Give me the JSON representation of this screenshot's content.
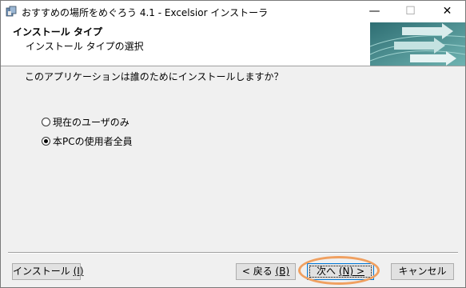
{
  "window": {
    "title": "おすすめの場所をめぐろう 4.1 - Excelsior インストーラ",
    "minimize_glyph": "—",
    "maximize_glyph": "☐",
    "close_glyph": "✕"
  },
  "header": {
    "title": "インストール タイプ",
    "subtitle": "インストール タイプの選択"
  },
  "content": {
    "question": "このアプリケーションは誰のためにインストールしますか？",
    "options": [
      {
        "label": "現在のユーザのみ",
        "selected": false
      },
      {
        "label": "本PCの使用者全員",
        "selected": true
      }
    ]
  },
  "footer": {
    "install_label": "インストール",
    "install_key": "(I)",
    "back_label": "< 戻る",
    "back_key": "(B)",
    "next_label": "次へ",
    "next_key": "(N) >",
    "cancel_label": "キャンセル"
  },
  "colors": {
    "highlight_ellipse": "#f0a060",
    "focus_border": "#0078d7",
    "banner_teal": "#5f9ea0"
  },
  "icons": [
    "app-installer-icon",
    "minimize-icon",
    "maximize-icon",
    "close-icon",
    "arrows-banner-icon"
  ]
}
